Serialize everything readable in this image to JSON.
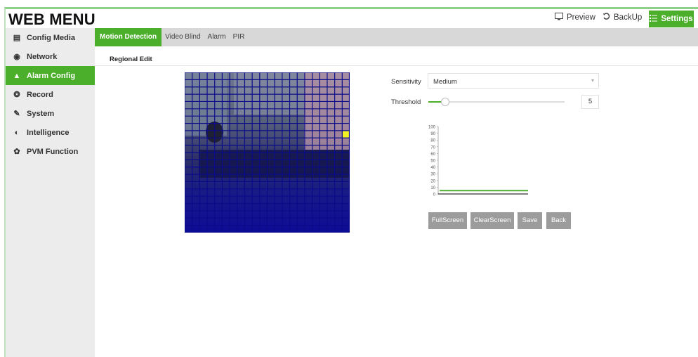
{
  "header": {
    "title": "WEB MENU",
    "preview_label": "Preview",
    "backup_label": "BackUp",
    "settings_label": "Settings"
  },
  "sidebar": {
    "items": [
      {
        "label": "Config Media",
        "icon": "file-icon"
      },
      {
        "label": "Network",
        "icon": "globe-icon"
      },
      {
        "label": "Alarm Config",
        "icon": "user-alarm-icon",
        "active": true
      },
      {
        "label": "Record",
        "icon": "record-icon"
      },
      {
        "label": "System",
        "icon": "wrench-icon"
      },
      {
        "label": "Intelligence",
        "icon": "brain-icon"
      },
      {
        "label": "PVM Function",
        "icon": "gear-icon"
      }
    ]
  },
  "tabs": [
    {
      "label": "Motion Detection",
      "active": true
    },
    {
      "label": "Video Blind"
    },
    {
      "label": "Alarm"
    },
    {
      "label": "PIR"
    }
  ],
  "section": {
    "title": "Regional Edit"
  },
  "settings": {
    "sensitivity_label": "Sensitivity",
    "sensitivity_value": "Medium",
    "threshold_label": "Threshold",
    "threshold_value": "5",
    "threshold_max": 100
  },
  "chart_data": {
    "type": "line",
    "y_ticks": [
      "100",
      "90",
      "80",
      "70",
      "60",
      "50",
      "40",
      "30",
      "20",
      "10",
      "0"
    ],
    "ylim": [
      0,
      100
    ],
    "series": [
      {
        "values": [
          5,
          5
        ]
      }
    ]
  },
  "grid": {
    "cols": 22,
    "rows": 22,
    "highlighted_cell": {
      "col": 21,
      "row": 8
    }
  },
  "buttons": {
    "fullscreen": "FullScreen",
    "clearscreen": "ClearScreen",
    "save": "Save",
    "back": "Back"
  },
  "colors": {
    "accent": "#4caf2c",
    "grid_line": "#0b0b8a",
    "highlight_cell": "#f2f224",
    "button_gray": "#9c9c9c"
  }
}
